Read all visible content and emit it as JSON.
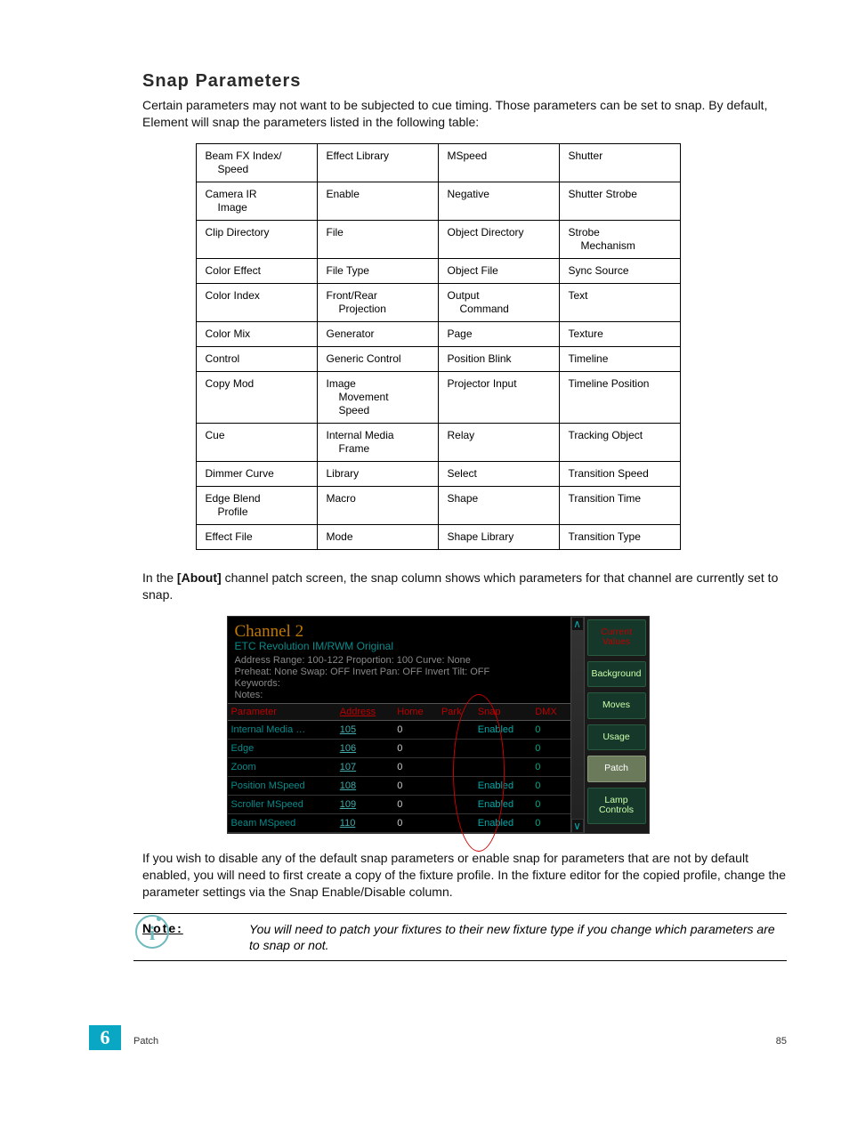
{
  "heading": "Snap Parameters",
  "intro": "Certain parameters may not want to be subjected to cue timing. Those parameters can be set to snap. By default, Element will snap the parameters listed in the following table:",
  "snap_table": [
    [
      "Beam FX Index/\n   Speed",
      "Effect Library",
      "MSpeed",
      "Shutter"
    ],
    [
      "Camera IR\n   Image",
      "Enable",
      "Negative",
      "Shutter Strobe"
    ],
    [
      "Clip Directory",
      "File",
      "Object Directory",
      "Strobe\n   Mechanism"
    ],
    [
      "Color Effect",
      "File Type",
      "Object File",
      "Sync Source"
    ],
    [
      "Color Index",
      "Front/Rear\n   Projection",
      "Output\n   Command",
      "Text"
    ],
    [
      "Color Mix",
      "Generator",
      "Page",
      "Texture"
    ],
    [
      "Control",
      "Generic Control",
      "Position Blink",
      "Timeline"
    ],
    [
      "Copy Mod",
      "Image\n   Movement\n   Speed",
      "Projector Input",
      "Timeline Position"
    ],
    [
      "Cue",
      "Internal Media\n   Frame",
      "Relay",
      "Tracking Object"
    ],
    [
      "Dimmer Curve",
      "Library",
      "Select",
      "Transition Speed"
    ],
    [
      "Edge Blend\n   Profile",
      "Macro",
      "Shape",
      "Transition Time"
    ],
    [
      "Effect File",
      "Mode",
      "Shape Library",
      "Transition Type"
    ]
  ],
  "mid_para_prefix": "In the ",
  "mid_para_bold": "[About]",
  "mid_para_suffix": " channel patch screen, the snap column shows which parameters for that channel are currently set to snap.",
  "channel_shot": {
    "title": "Channel 2",
    "subtitle": "ETC Revolution IM/RWM Original",
    "meta_lines": [
      "Address Range: 100-122  Proportion: 100  Curve: None",
      "Preheat: None  Swap: OFF  Invert Pan: OFF  Invert Tilt: OFF",
      "Keywords:",
      "Notes:"
    ],
    "columns": [
      "Parameter",
      "Address",
      "Home",
      "Park",
      "Snap",
      "DMX"
    ],
    "rows": [
      {
        "param": "Internal Media …",
        "addr": "105",
        "home": "0",
        "park": "",
        "snap": "Enabled",
        "dmx": "0"
      },
      {
        "param": "Edge",
        "addr": "106",
        "home": "0",
        "park": "",
        "snap": "",
        "dmx": "0"
      },
      {
        "param": "Zoom",
        "addr": "107",
        "home": "0",
        "park": "",
        "snap": "",
        "dmx": "0"
      },
      {
        "param": "Position MSpeed",
        "addr": "108",
        "home": "0",
        "park": "",
        "snap": "Enabled",
        "dmx": "0"
      },
      {
        "param": "Scroller MSpeed",
        "addr": "109",
        "home": "0",
        "park": "",
        "snap": "Enabled",
        "dmx": "0"
      },
      {
        "param": "Beam MSpeed",
        "addr": "110",
        "home": "0",
        "park": "",
        "snap": "Enabled",
        "dmx": "0"
      }
    ],
    "side_buttons": [
      "Current\nValues",
      "Background",
      "Moves",
      "Usage",
      "Patch",
      "Lamp\nControls"
    ],
    "scroll": {
      "up": "∧",
      "down": "∨"
    }
  },
  "after_para": "If you wish to disable any of the default snap parameters or enable snap for parameters that are not by default enabled, you will need to first create a copy of the fixture profile. In the fixture editor for the copied profile, change the parameter settings via the Snap Enable/Disable column.",
  "note": {
    "label": "Note:",
    "text": "You will need to patch your fixtures to their new fixture type if you change which parameters are to snap or not."
  },
  "footer": {
    "chapter": "6",
    "left": "Patch",
    "right": "85"
  }
}
